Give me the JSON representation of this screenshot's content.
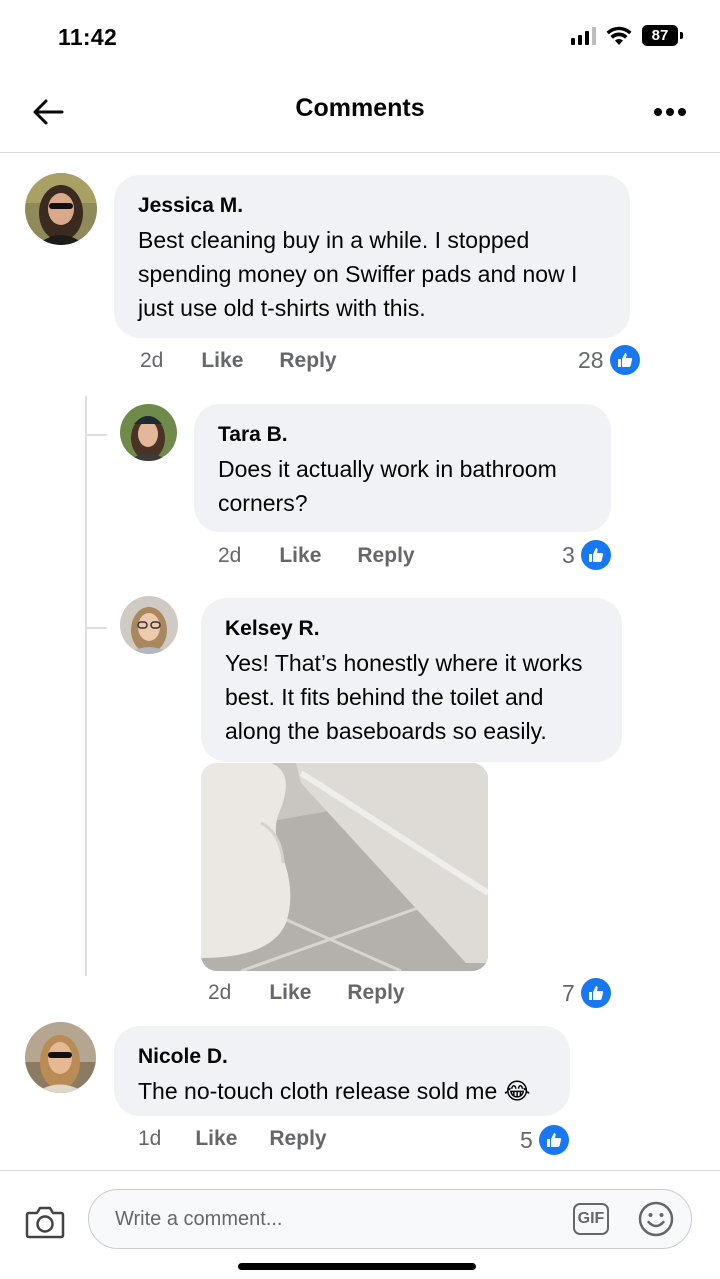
{
  "status_bar": {
    "time": "11:42",
    "battery": "87"
  },
  "header": {
    "title": "Comments"
  },
  "comments": [
    {
      "author": "Jessica M.",
      "text": "Best cleaning buy in a while. I stopped spending money on Swiffer pads and now I just use old t-shirts with this.",
      "time": "2d",
      "like_label": "Like",
      "reply_label": "Reply",
      "likes": "28"
    },
    {
      "author": "Tara B.",
      "text": "Does it actually work in bathroom corners?",
      "time": "2d",
      "like_label": "Like",
      "reply_label": "Reply",
      "likes": "3"
    },
    {
      "author": "Kelsey R.",
      "text": "Yes! That’s honestly where it works best. It fits behind the toilet and along the baseboards so easily.",
      "time": "2d",
      "like_label": "Like",
      "reply_label": "Reply",
      "likes": "7",
      "has_photo": true
    },
    {
      "author": "Nicole D.",
      "text": "The no-touch cloth release sold me",
      "emoji": "😂",
      "time": "1d",
      "like_label": "Like",
      "reply_label": "Reply",
      "likes": "5"
    }
  ],
  "composer": {
    "placeholder": "Write a comment...",
    "gif_label": "GIF"
  },
  "colors": {
    "accent": "#1877f2",
    "bubble": "#f0f2f5",
    "secondary_text": "#65676b"
  }
}
